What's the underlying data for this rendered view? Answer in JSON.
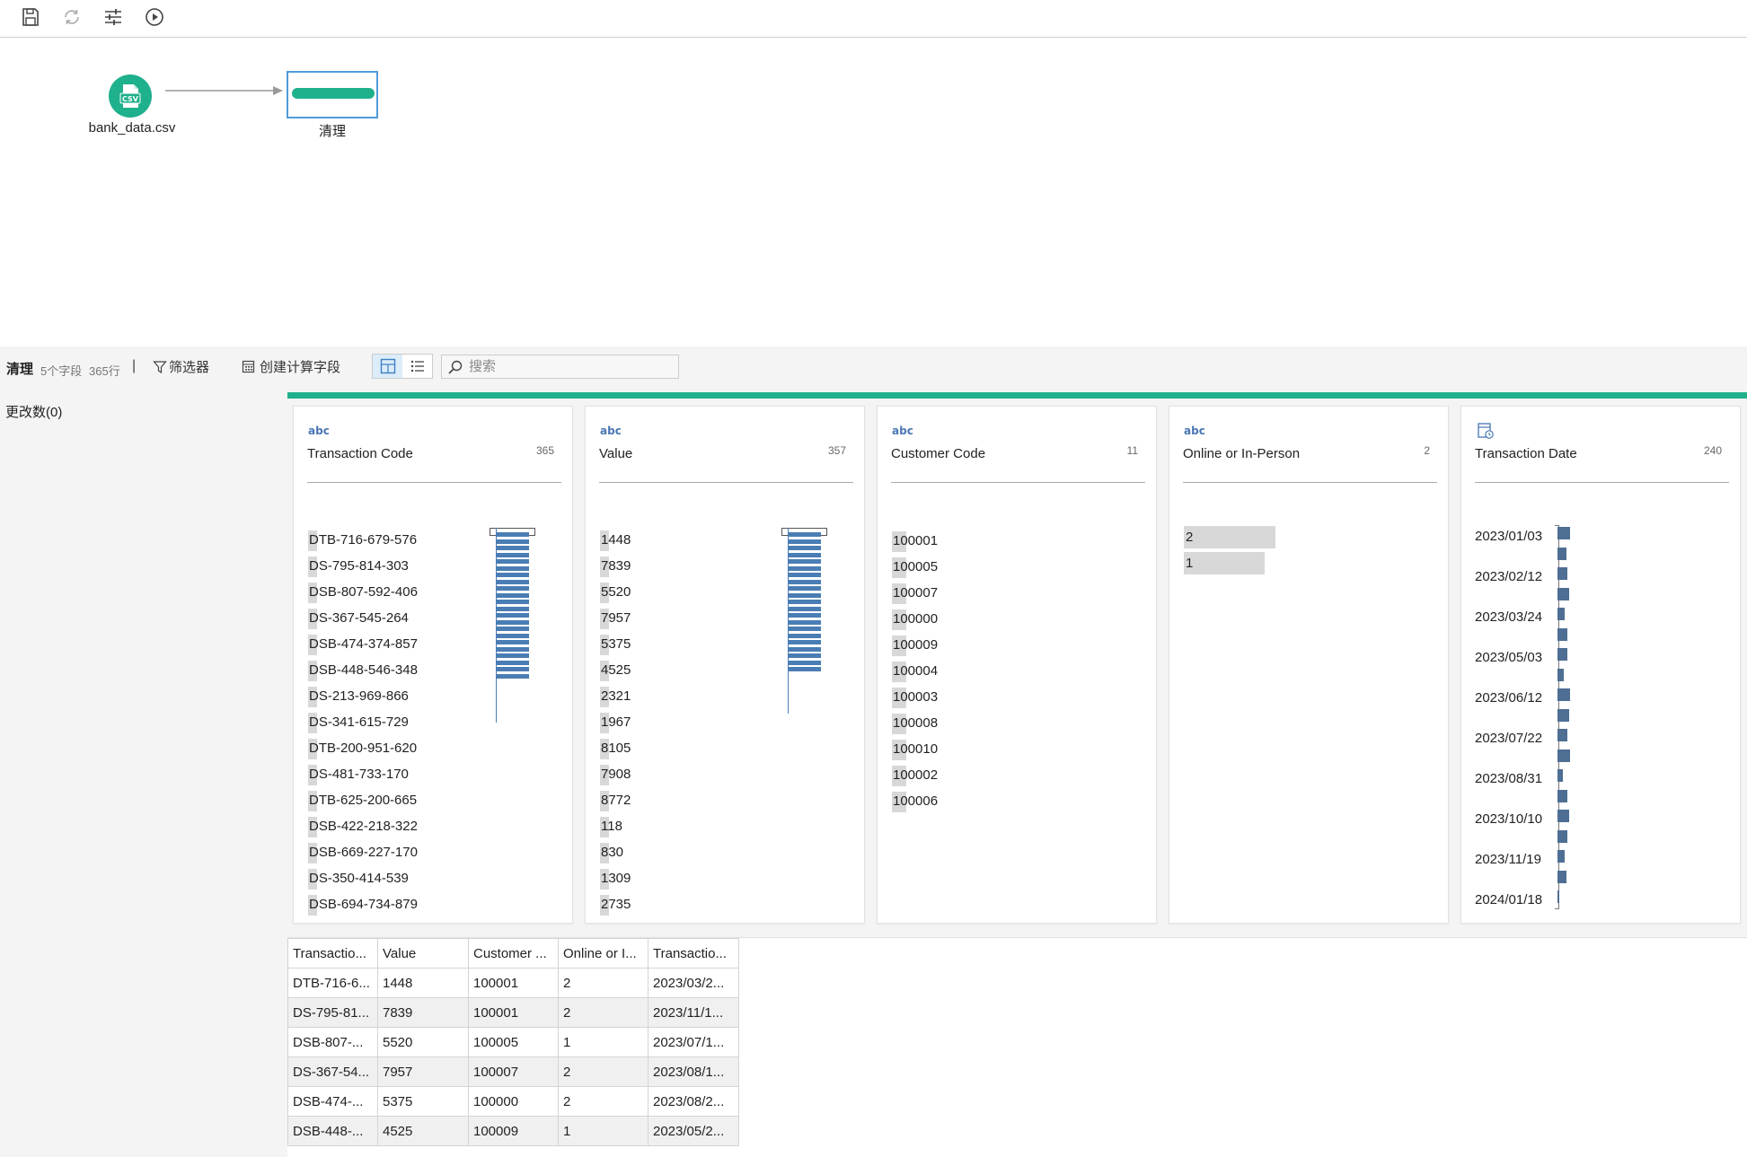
{
  "toolbar": {
    "buttons": [
      {
        "icon": "save-icon"
      },
      {
        "icon": "refresh-icon"
      },
      {
        "icon": "settings-sliders-icon"
      },
      {
        "icon": "run-icon"
      }
    ]
  },
  "flow": {
    "source_node": {
      "icon": "csv-icon",
      "badge": "CSV",
      "label": "bank_data.csv"
    },
    "clean_node": {
      "label": "清理"
    }
  },
  "panel": {
    "title": "清理",
    "fields_info": "5个字段",
    "rows_info": "365行",
    "separator": "|",
    "filter_label": "筛选器",
    "calc_field_label": "创建计算字段",
    "search_placeholder": "搜索",
    "changes_label": "更改数(0)"
  },
  "cards": [
    {
      "type_label": "abc",
      "name": "Transaction Code",
      "count": "365",
      "values": [
        "DTB-716-679-576",
        "DS-795-814-303",
        "DSB-807-592-406",
        "DS-367-545-264",
        "DSB-474-374-857",
        "DSB-448-546-348",
        "DS-213-969-866",
        "DS-341-615-729",
        "DTB-200-951-620",
        "DS-481-733-170",
        "DTB-625-200-665",
        "DSB-422-218-322",
        "DSB-669-227-170",
        "DS-350-414-539",
        "DSB-694-734-879"
      ]
    },
    {
      "type_label": "abc",
      "name": "Value",
      "count": "357",
      "values": [
        "1448",
        "7839",
        "5520",
        "7957",
        "5375",
        "4525",
        "2321",
        "1967",
        "8105",
        "7908",
        "8772",
        "118",
        "830",
        "1309",
        "2735"
      ]
    },
    {
      "type_label": "abc",
      "name": "Customer Code",
      "count": "11",
      "values": [
        "100001",
        "100005",
        "100007",
        "100000",
        "100009",
        "100004",
        "100003",
        "100008",
        "100010",
        "100002",
        "100006"
      ]
    },
    {
      "type_label": "abc",
      "name": "Online or In-Person",
      "count": "2",
      "values": [
        "2",
        "1"
      ],
      "bar_fractions": [
        1.0,
        0.88
      ]
    },
    {
      "type_label": "date",
      "type_icon": "calendar-date-icon",
      "name": "Transaction Date",
      "count": "240",
      "date_labels": [
        "2023/01/03",
        "2023/02/12",
        "2023/03/24",
        "2023/05/03",
        "2023/06/12",
        "2023/07/22",
        "2023/08/31",
        "2023/10/10",
        "2023/11/19",
        "2024/01/18"
      ],
      "histogram_fractions": [
        1.0,
        0.7,
        0.8,
        0.9,
        0.6,
        0.8,
        0.8,
        0.5,
        1.0,
        0.9,
        0.8,
        1.0,
        0.4,
        0.8,
        0.9,
        0.8,
        0.6,
        0.7,
        0.1
      ]
    }
  ],
  "table": {
    "headers": [
      "Transactio...",
      "Value",
      "Customer ...",
      "Online or I...",
      "Transactio..."
    ],
    "rows": [
      [
        "DTB-716-6...",
        "1448",
        "100001",
        "2",
        "2023/03/2..."
      ],
      [
        "DS-795-81...",
        "7839",
        "100001",
        "2",
        "2023/11/1..."
      ],
      [
        "DSB-807-...",
        "5520",
        "100005",
        "1",
        "2023/07/1..."
      ],
      [
        "DS-367-54...",
        "7957",
        "100007",
        "2",
        "2023/08/1..."
      ],
      [
        "DSB-474-...",
        "5375",
        "100000",
        "2",
        "2023/08/2..."
      ],
      [
        "DSB-448-...",
        "4525",
        "100009",
        "1",
        "2023/05/2..."
      ]
    ]
  },
  "colors": {
    "accent_green": "#1fb08c",
    "node_border_blue": "#4f9bd9",
    "type_blue": "#4a77b4",
    "bar_blue": "#4a7db4",
    "date_bar": "#4e6e93",
    "highlight_gray": "#d8d8d8"
  }
}
